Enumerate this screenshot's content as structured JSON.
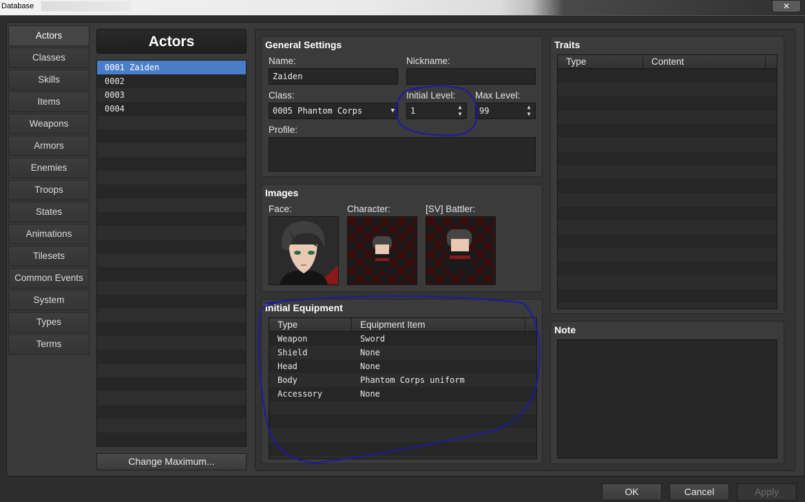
{
  "window": {
    "title": "Database",
    "close_label": "✕"
  },
  "sidebar": {
    "items": [
      {
        "label": "Actors"
      },
      {
        "label": "Classes"
      },
      {
        "label": "Skills"
      },
      {
        "label": "Items"
      },
      {
        "label": "Weapons"
      },
      {
        "label": "Armors"
      },
      {
        "label": "Enemies"
      },
      {
        "label": "Troops"
      },
      {
        "label": "States"
      },
      {
        "label": "Animations"
      },
      {
        "label": "Tilesets"
      },
      {
        "label": "Common Events"
      },
      {
        "label": "System"
      },
      {
        "label": "Types"
      },
      {
        "label": "Terms"
      }
    ],
    "active_index": 0
  },
  "actor_list": {
    "header": "Actors",
    "items": [
      "0001 Zaiden",
      "0002",
      "0003",
      "0004"
    ],
    "selected_index": 0,
    "change_max_label": "Change Maximum..."
  },
  "general": {
    "title": "General Settings",
    "name_label": "Name:",
    "name_value": "Zaiden",
    "nickname_label": "Nickname:",
    "nickname_value": "",
    "class_label": "Class:",
    "class_value": "0005 Phantom Corps",
    "initial_level_label": "Initial Level:",
    "initial_level_value": "1",
    "max_level_label": "Max Level:",
    "max_level_value": "99",
    "profile_label": "Profile:",
    "profile_value": ""
  },
  "images": {
    "title": "Images",
    "face_label": "Face:",
    "character_label": "Character:",
    "battler_label": "[SV] Battler:"
  },
  "equipment": {
    "title": "Initial Equipment",
    "columns": [
      "Type",
      "Equipment Item"
    ],
    "rows": [
      {
        "type": "Weapon",
        "item": "Sword"
      },
      {
        "type": "Shield",
        "item": "None"
      },
      {
        "type": "Head",
        "item": "None"
      },
      {
        "type": "Body",
        "item": "Phantom Corps uniform"
      },
      {
        "type": "Accessory",
        "item": "None"
      }
    ]
  },
  "traits": {
    "title": "Traits",
    "columns": [
      "Type",
      "Content"
    ]
  },
  "note": {
    "title": "Note",
    "value": ""
  },
  "footer": {
    "ok_label": "OK",
    "cancel_label": "Cancel",
    "apply_label": "Apply"
  },
  "colors": {
    "selection": "#4a7ec9",
    "annotation": "#1a1aa8"
  }
}
